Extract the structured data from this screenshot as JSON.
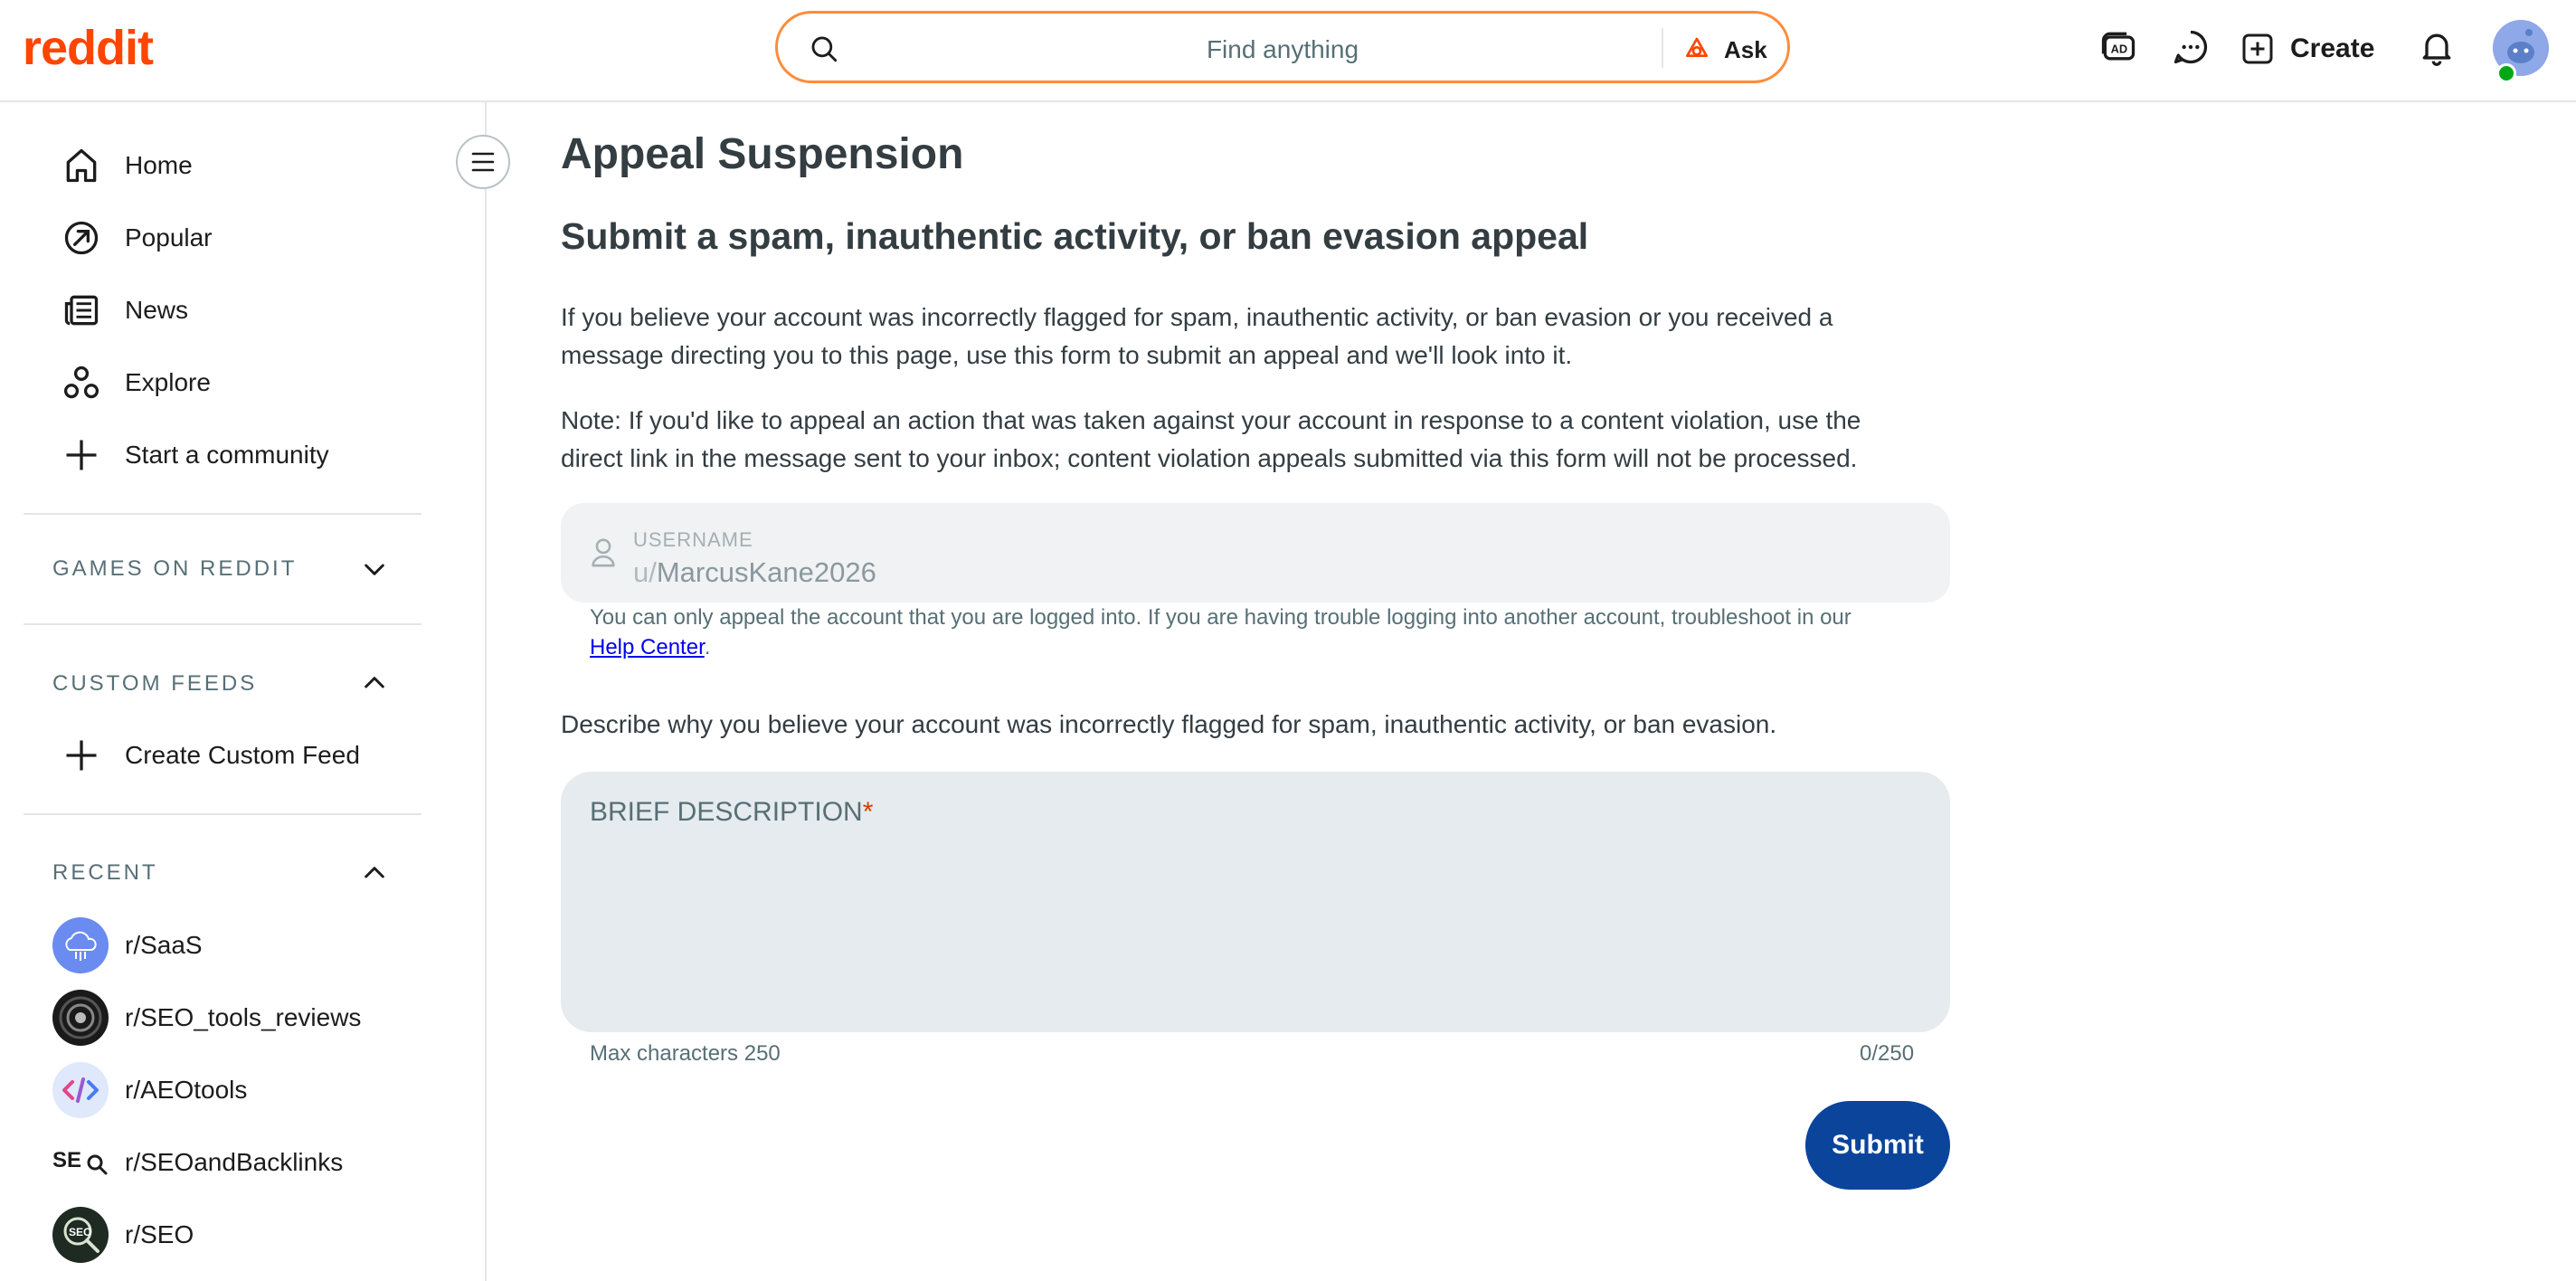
{
  "header": {
    "logo": "reddit",
    "search_placeholder": "Find anything",
    "ask_label": "Ask",
    "create_label": "Create",
    "icons": [
      "advertise-icon",
      "chat-icon",
      "create-icon",
      "notification-icon"
    ]
  },
  "sidebar": {
    "nav": [
      {
        "label": "Home",
        "icon": "home-icon"
      },
      {
        "label": "Popular",
        "icon": "popular-icon"
      },
      {
        "label": "News",
        "icon": "news-icon"
      },
      {
        "label": "Explore",
        "icon": "explore-icon"
      },
      {
        "label": "Start a community",
        "icon": "plus-icon"
      }
    ],
    "games_heading": "GAMES ON REDDIT",
    "custom_feeds_heading": "CUSTOM FEEDS",
    "create_custom_feed": "Create Custom Feed",
    "recent_heading": "RECENT",
    "recent": [
      {
        "label": "r/SaaS"
      },
      {
        "label": "r/SEO_tools_reviews"
      },
      {
        "label": "r/AEOtools"
      },
      {
        "label": "r/SEOandBacklinks"
      },
      {
        "label": "r/SEO"
      }
    ]
  },
  "main": {
    "title": "Appeal Suspension",
    "subtitle": "Submit a spam, inauthentic activity, or ban evasion appeal",
    "para1_line1": "If you believe your account was incorrectly flagged for spam, inauthentic activity, or ban evasion or you received a",
    "para1_line2": "message directing you to this page, use this form to submit an appeal and we'll look into it.",
    "para2_line1": "Note: If you'd like to appeal an action that was taken against your account in response to a content violation, use the",
    "para2_line2": "direct link in the message sent to your inbox; content violation appeals submitted via this form will not be processed.",
    "username_label": "USERNAME",
    "username_prefix": "u/",
    "username_value": "MarcusKane2026",
    "helper_text": "You can only appeal the account that you are logged into. If you are having trouble logging into another account, troubleshoot in our",
    "help_center_link": "Help Center",
    "helper_period": ".",
    "describe_label": "Describe why you believe your account was incorrectly flagged for spam, inauthentic activity, or ban evasion.",
    "description_label": "BRIEF DESCRIPTION",
    "description_required_mark": "*",
    "max_chars": "Max characters 250",
    "char_count": "0/250",
    "submit_label": "Submit"
  },
  "colors": {
    "brand": "#ff4500",
    "submit": "#0a449b",
    "link": "#0000ee"
  }
}
